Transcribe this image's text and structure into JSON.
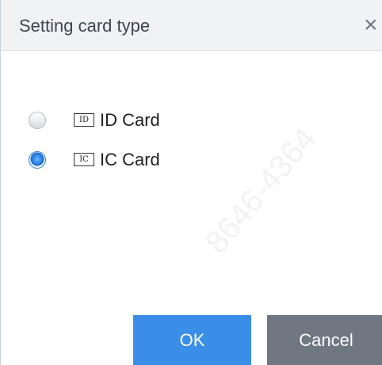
{
  "dialog": {
    "title": "Setting card type",
    "close_symbol": "×",
    "close_icon": "close-icon"
  },
  "options": [
    {
      "badge": "ID",
      "label": "ID Card",
      "selected": false
    },
    {
      "badge": "IC",
      "label": "IC Card",
      "selected": true
    }
  ],
  "watermark": "8646-4364",
  "buttons": {
    "ok_label": "OK",
    "cancel_label": "Cancel"
  },
  "colors": {
    "ok_button": "#3a8ee8",
    "cancel_button": "#6f7882",
    "title_bar": "#f0f2f4",
    "radio_selected": "#2f85e6"
  }
}
